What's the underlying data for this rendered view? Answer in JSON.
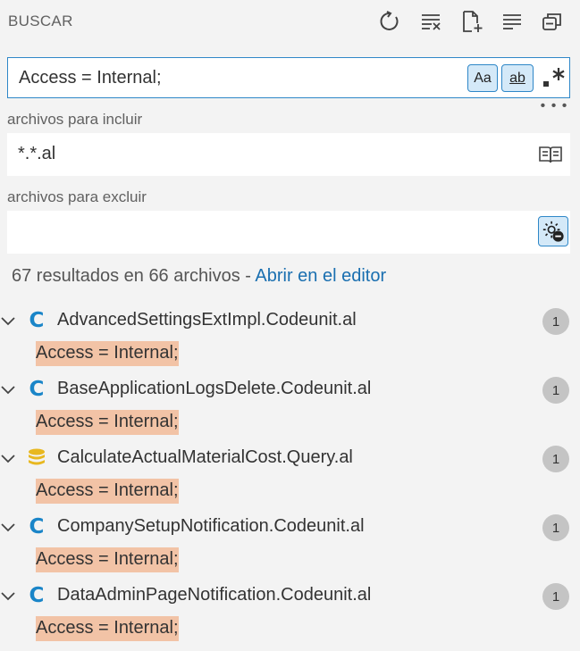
{
  "header": {
    "title": "BUSCAR",
    "icons": [
      "refresh-icon",
      "clear-results-icon",
      "new-search-editor-icon",
      "view-as-tree-icon",
      "collapse-all-icon"
    ]
  },
  "search": {
    "value": "Access = Internal;",
    "match_case_label": "Aa",
    "whole_word_label": "ab",
    "regex_label": ".*"
  },
  "include": {
    "label": "archivos para incluir",
    "value": "*.*.al"
  },
  "exclude": {
    "label": "archivos para excluir",
    "value": ""
  },
  "summary": {
    "text": "67 resultados en 66 archivos - ",
    "link": "Abrir en el editor"
  },
  "results": [
    {
      "file": "AdvancedSettingsExtImpl.Codeunit.al",
      "icon": "codeunit-icon",
      "count": "1",
      "match": "Access = Internal;"
    },
    {
      "file": "BaseApplicationLogsDelete.Codeunit.al",
      "icon": "codeunit-icon",
      "count": "1",
      "match": "Access = Internal;"
    },
    {
      "file": "CalculateActualMaterialCost.Query.al",
      "icon": "query-icon",
      "count": "1",
      "match": "Access = Internal;"
    },
    {
      "file": "CompanySetupNotification.Codeunit.al",
      "icon": "codeunit-icon",
      "count": "1",
      "match": "Access = Internal;"
    },
    {
      "file": "DataAdminPageNotification.Codeunit.al",
      "icon": "codeunit-icon",
      "count": "1",
      "match": "Access = Internal;"
    }
  ],
  "colors": {
    "accent": "#2e87c8",
    "match_highlight": "#f2c3a6",
    "codeunit_icon": "#1a85c8",
    "query_icon": "#e8b820",
    "link": "#1a6fb0"
  }
}
